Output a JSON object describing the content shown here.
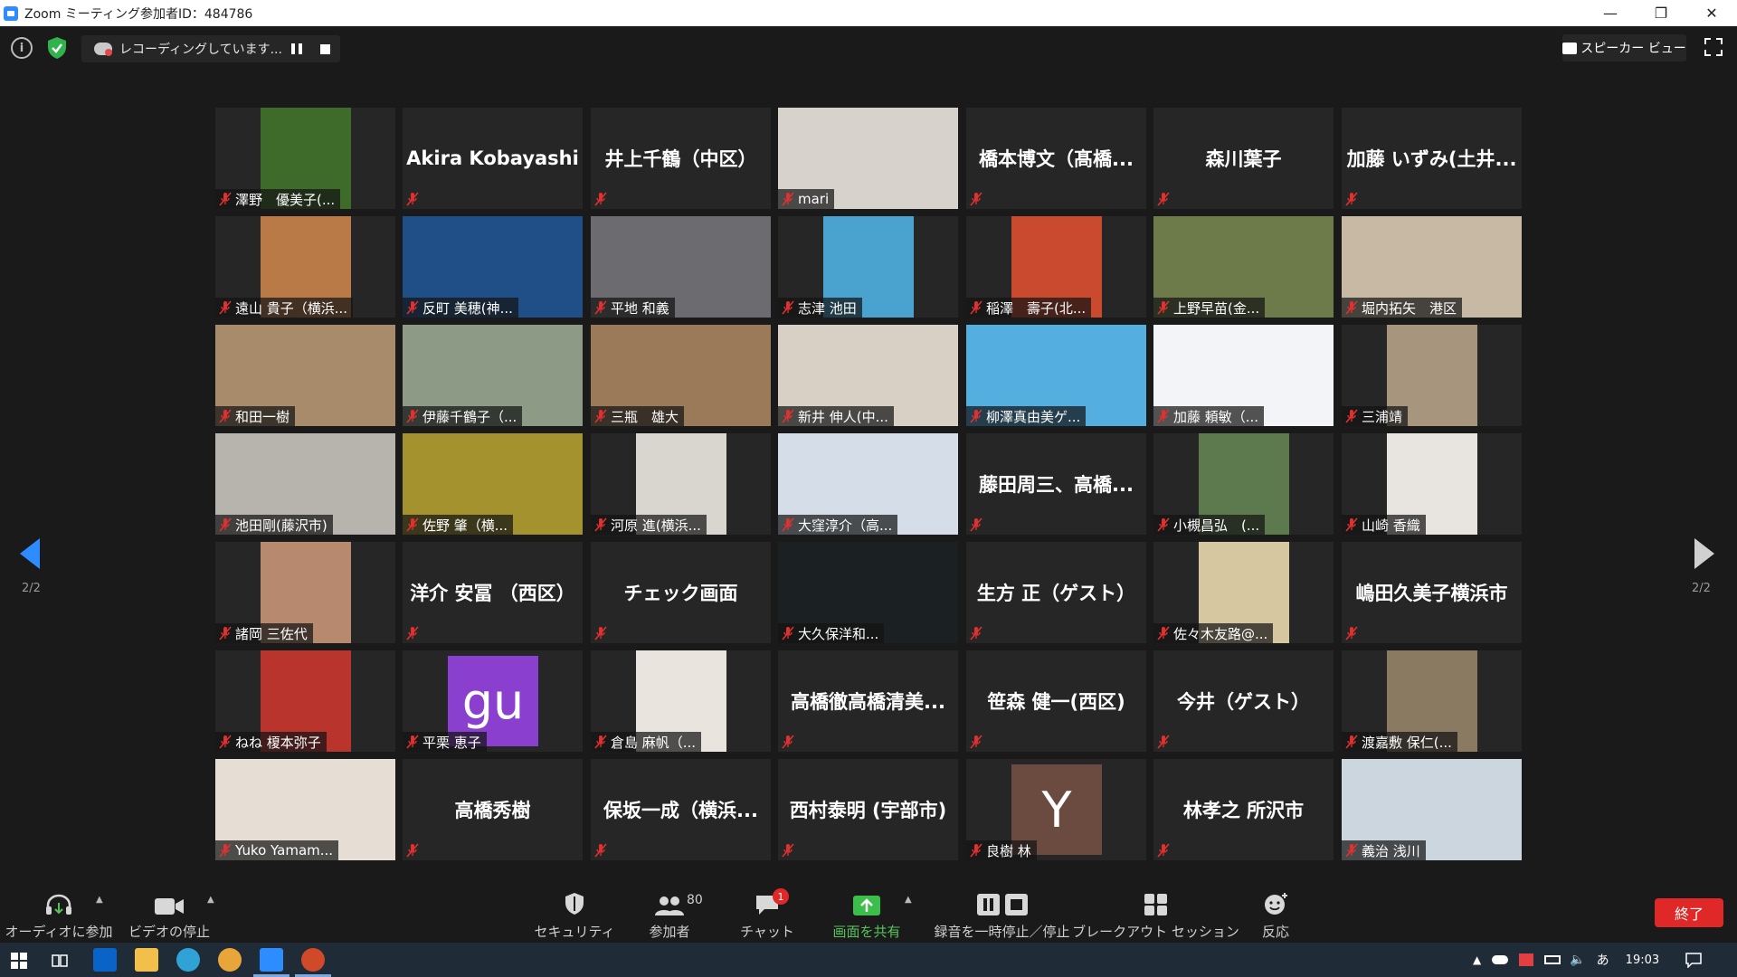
{
  "window": {
    "title": "Zoom ミーティング参加者ID：484786",
    "minimize": "—",
    "restore": "❐",
    "close": "✕"
  },
  "topbar": {
    "info_icon": "i",
    "recording_text": "レコーディングしています...",
    "speaker_view_label": "スピーカー ビュー"
  },
  "gallery": {
    "page_left": "2/2",
    "page_right": "2/2",
    "tiles": [
      {
        "name": "澤野　優美子(...",
        "display": "",
        "video": "#3e6b2a"
      },
      {
        "name": "",
        "display": "Akira Kobayashi",
        "video": ""
      },
      {
        "name": "",
        "display": "井上千鶴（中区）",
        "video": ""
      },
      {
        "name": "mari",
        "display": "",
        "video": "#d8d2cc"
      },
      {
        "name": "",
        "display": "橋本博文（髙橋...",
        "video": ""
      },
      {
        "name": "",
        "display": "森川葉子",
        "video": ""
      },
      {
        "name": "",
        "display": "加藤 いずみ(土井...",
        "video": ""
      },
      {
        "name": "遠山 貴子（横浜...",
        "display": "",
        "video": "#b97a48"
      },
      {
        "name": "反町 美穂(神...",
        "display": "",
        "video": "#1f4f86"
      },
      {
        "name": "平地 和義",
        "display": "",
        "video": "#6b6b70"
      },
      {
        "name": "志津 池田",
        "display": "",
        "video": "#4aa3cf"
      },
      {
        "name": "稲澤　壽子(北...",
        "display": "",
        "video": "#c94a2e"
      },
      {
        "name": "上野早苗(金...",
        "display": "",
        "video": "#6d7a4a"
      },
      {
        "name": "堀内拓矢　港区",
        "display": "",
        "video": "#c8b9a4"
      },
      {
        "name": "和田一樹",
        "display": "",
        "video": "#a88b6a"
      },
      {
        "name": "伊藤千鶴子（...",
        "display": "",
        "video": "#8d9a86"
      },
      {
        "name": "三瓶　雄大",
        "display": "",
        "video": "#9b7a5a"
      },
      {
        "name": "新井 伸人(中...",
        "display": "",
        "video": "#d8d0c4"
      },
      {
        "name": "柳澤真由美ゲ...",
        "display": "",
        "video": "#55aee0"
      },
      {
        "name": "加藤 頼敏（...",
        "display": "",
        "video": "#f2f4f8"
      },
      {
        "name": "三浦靖",
        "display": "",
        "video": "#a8957e"
      },
      {
        "name": "池田剛(藤沢市)",
        "display": "",
        "video": "#b7b4ae"
      },
      {
        "name": "佐野 肇（横...",
        "display": "",
        "video": "#a3922e"
      },
      {
        "name": "河原 進(横浜...",
        "display": "",
        "video": "#d9d6d0"
      },
      {
        "name": "大窪淳介（高...",
        "display": "",
        "video": "#d4dde8"
      },
      {
        "name": "",
        "display": "藤田周三、高橋...",
        "video": ""
      },
      {
        "name": "小槻昌弘　(...",
        "display": "",
        "video": "#5d7a4e"
      },
      {
        "name": "山崎 香織",
        "display": "",
        "video": "#e8e4e0"
      },
      {
        "name": "諸岡 三佐代",
        "display": "",
        "video": "#b78a70"
      },
      {
        "name": "",
        "display": "洋介 安冨 （西区）",
        "video": ""
      },
      {
        "name": "",
        "display": "チェック画面",
        "video": ""
      },
      {
        "name": "大久保洋和...",
        "display": "",
        "video": "#1b2123"
      },
      {
        "name": "",
        "display": "生方 正（ゲスト）",
        "video": ""
      },
      {
        "name": "佐々木友路@...",
        "display": "",
        "video": "#d6c7a0"
      },
      {
        "name": "",
        "display": "嶋田久美子横浜市",
        "video": ""
      },
      {
        "name": "ねね 榎本弥子",
        "display": "",
        "video": "#b8342c"
      },
      {
        "name": "平栗 恵子",
        "display": "",
        "video": "#8a3fcf",
        "avatar": "gu"
      },
      {
        "name": "倉島 麻帆（...",
        "display": "",
        "video": "#eae4df"
      },
      {
        "name": "",
        "display": "高橋徹高橋清美...",
        "video": ""
      },
      {
        "name": "",
        "display": "笹森 健一(西区)",
        "video": ""
      },
      {
        "name": "",
        "display": "今井（ゲスト）",
        "video": ""
      },
      {
        "name": "渡嘉敷 保仁(...",
        "display": "",
        "video": "#8a7a62"
      },
      {
        "name": "Yuko Yamam...",
        "display": "",
        "video": "#e6ddd4"
      },
      {
        "name": "",
        "display": "高橋秀樹",
        "video": ""
      },
      {
        "name": "",
        "display": "保坂一成（横浜...",
        "video": ""
      },
      {
        "name": "",
        "display": "西村泰明 (宇部市)",
        "video": ""
      },
      {
        "name": "良樹 林",
        "display": "",
        "video": "#6b4a40",
        "avatar": "Y"
      },
      {
        "name": "",
        "display": "林孝之 所沢市",
        "video": ""
      },
      {
        "name": "義治 浅川",
        "display": "",
        "video": "#cbd6df"
      }
    ]
  },
  "toolbar": {
    "audio_label": "オーディオに参加",
    "video_label": "ビデオの停止",
    "security_label": "セキュリティ",
    "participants_label": "参加者",
    "participants_count": "80",
    "chat_label": "チャット",
    "chat_badge": "1",
    "share_label": "画面を共有",
    "record_label": "録音を一時停止／停止",
    "breakout_label": "ブレークアウト セッション",
    "reactions_label": "反応",
    "end_label": "終了"
  },
  "taskbar": {
    "ime": "あ",
    "time": "19:03"
  }
}
